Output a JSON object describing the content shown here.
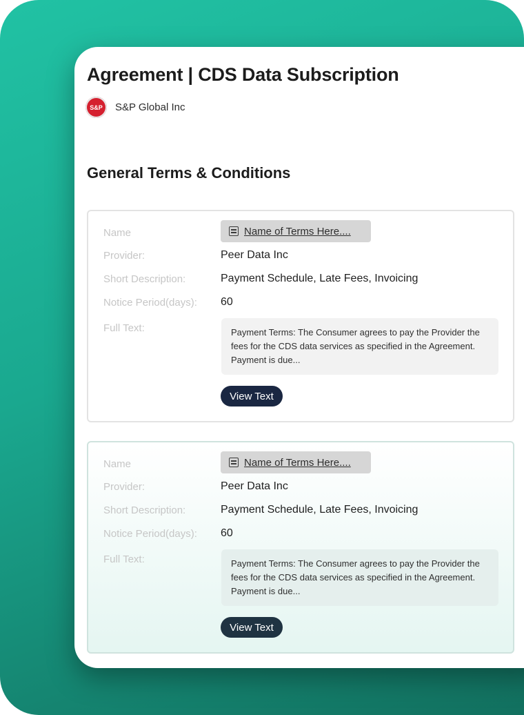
{
  "agreement": {
    "title": "Agreement | CDS Data Subscription",
    "company": "S&P Global Inc",
    "logo_text": "S&P"
  },
  "section_title": "General Terms & Conditions",
  "labels": {
    "name": "Name",
    "provider": "Provider:",
    "short_description": "Short Description:",
    "notice_period": "Notice Period(days):",
    "full_text": "Full Text:"
  },
  "terms": [
    {
      "name": "Name of Terms Here....",
      "provider": "Peer Data Inc",
      "short_description": "Payment Schedule, Late Fees, Invoicing",
      "notice_period": "60",
      "full_text": "Payment Terms: The Consumer agrees to pay the Provider the fees for the CDS data services as  specified in the Agreement. Payment is due...",
      "button_label": "View Text"
    },
    {
      "name": "Name of Terms Here....",
      "provider": "Peer Data Inc",
      "short_description": "Payment Schedule, Late Fees, Invoicing",
      "notice_period": "60",
      "full_text": "Payment Terms: The Consumer agrees to pay the Provider the fees for the CDS data services as  specified in the Agreement. Payment is due...",
      "button_label": "View Text"
    }
  ],
  "colors": {
    "frame_gradient_start": "#21c2a4",
    "frame_gradient_end": "#12705f",
    "logo_red": "#d5202f",
    "button_navy": "#1a2742"
  },
  "icons": {
    "logo": "sp-global-logo",
    "term_name": "document-icon"
  }
}
